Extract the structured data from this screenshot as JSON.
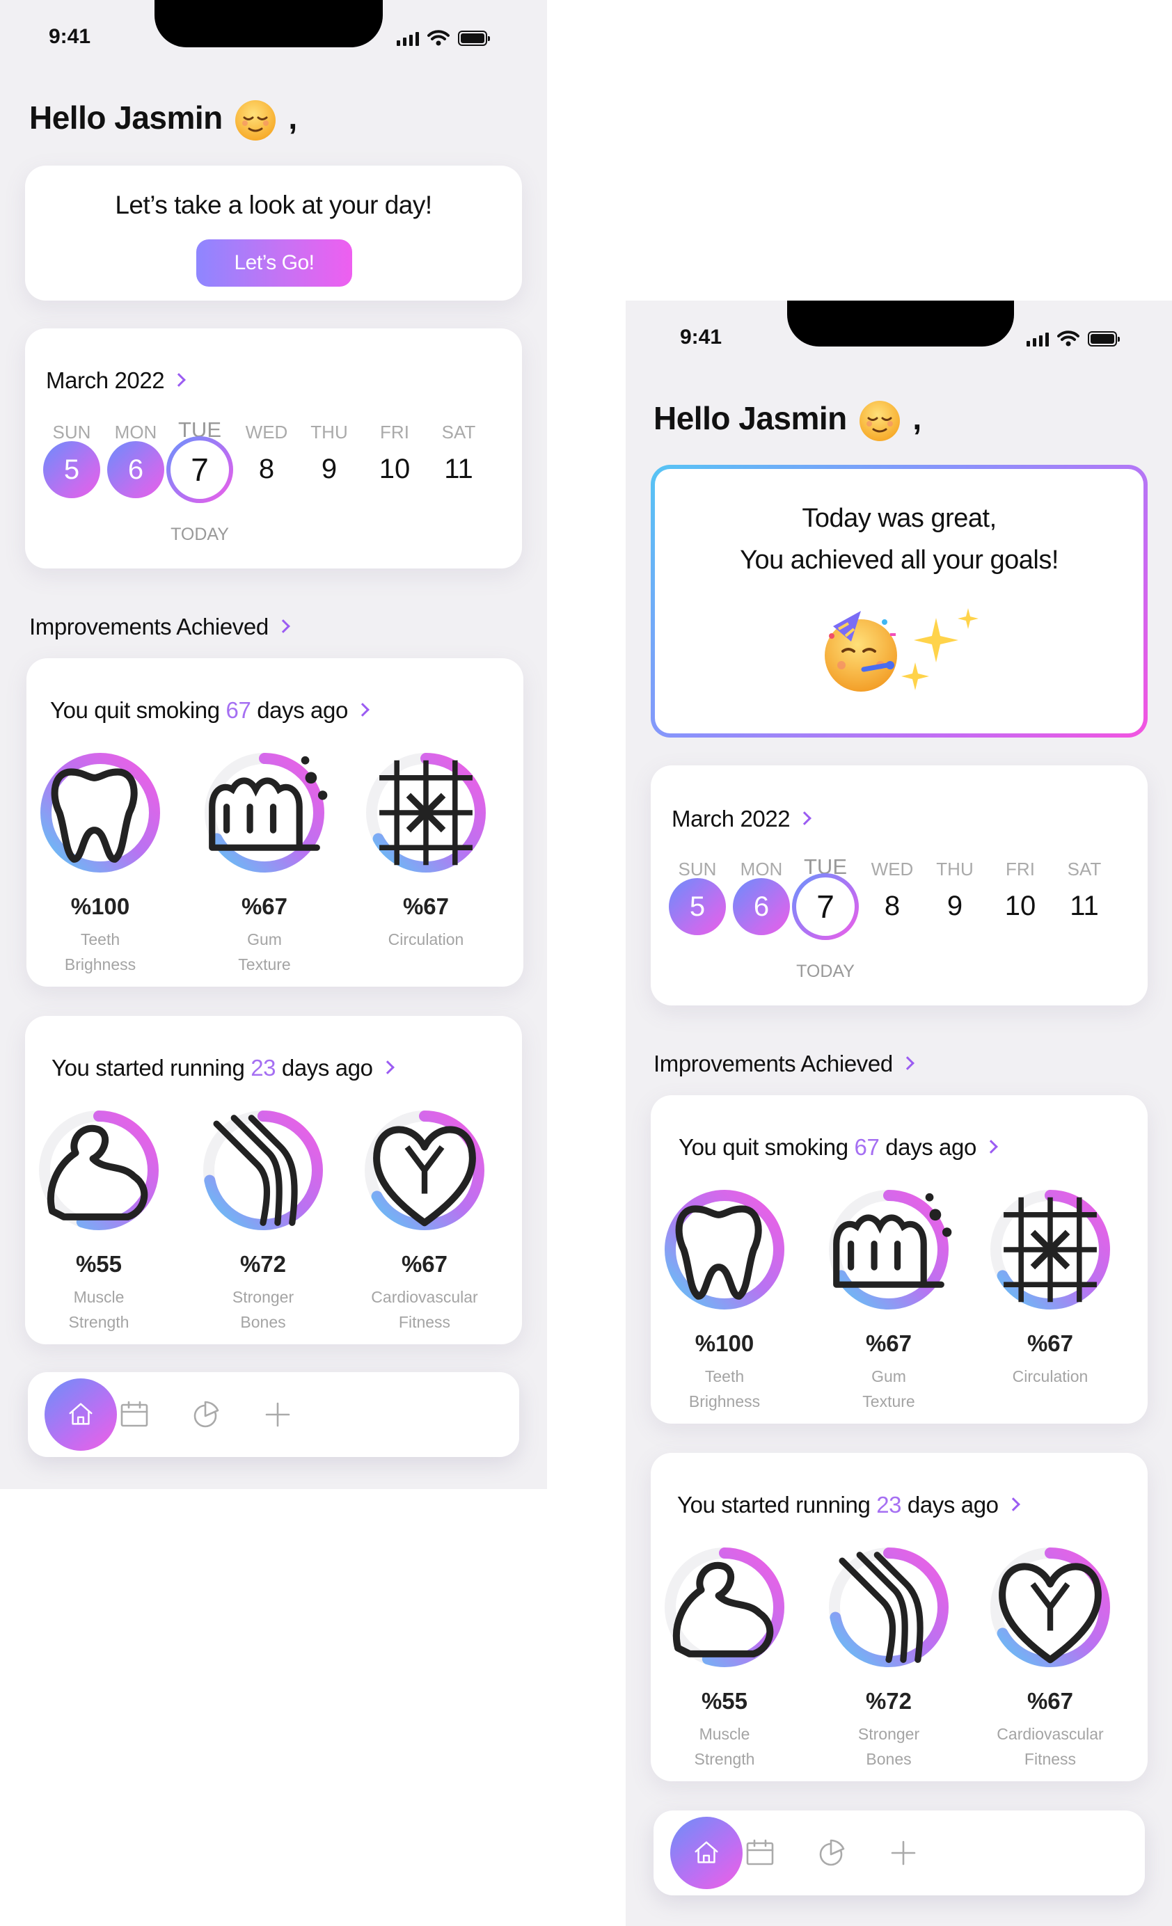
{
  "screen1": {
    "status": {
      "time": "9:41"
    },
    "greeting": {
      "text": "Hello Jasmin",
      "suffix": ","
    },
    "intro_card": {
      "title": "Let’s take a look at your day!",
      "button": "Let’s Go!"
    },
    "calendar": {
      "month": "March 2022",
      "days": [
        {
          "name": "SUN",
          "num": "5",
          "state": "done"
        },
        {
          "name": "MON",
          "num": "6",
          "state": "done"
        },
        {
          "name": "TUE",
          "num": "7",
          "state": "today"
        },
        {
          "name": "WED",
          "num": "8",
          "state": ""
        },
        {
          "name": "THU",
          "num": "9",
          "state": ""
        },
        {
          "name": "FRI",
          "num": "10",
          "state": ""
        },
        {
          "name": "SAT",
          "num": "11",
          "state": ""
        }
      ],
      "today_label": "TODAY"
    },
    "improvements_title": "Improvements Achieved",
    "smoking": {
      "pre": "You quit smoking",
      "num": "67",
      "post": "days ago",
      "metrics": [
        {
          "value": "%100",
          "fraction": 1.0,
          "line1": "Teeth",
          "line2": "Brighness",
          "icon": "tooth-icon"
        },
        {
          "value": "%67",
          "fraction": 0.67,
          "line1": "Gum",
          "line2": "Texture",
          "icon": "gum-icon"
        },
        {
          "value": "%67",
          "fraction": 0.67,
          "line1": "Circulation",
          "line2": "",
          "icon": "circulation-icon"
        }
      ]
    },
    "running": {
      "pre": "You started running",
      "num": "23",
      "post": "days ago",
      "metrics": [
        {
          "value": "%55",
          "fraction": 0.55,
          "line1": "Muscle",
          "line2": "Strength",
          "icon": "muscle-icon"
        },
        {
          "value": "%72",
          "fraction": 0.72,
          "line1": "Stronger",
          "line2": "Bones",
          "icon": "bone-icon"
        },
        {
          "value": "%67",
          "fraction": 0.67,
          "line1": "Cardiovascular",
          "line2": "Fitness",
          "icon": "heart-icon"
        }
      ]
    },
    "nav": {
      "items": [
        "home-icon",
        "calendar-icon",
        "chart-icon",
        "plus-icon"
      ],
      "active": "home-icon"
    }
  },
  "screen2": {
    "status": {
      "time": "9:41"
    },
    "greeting": {
      "text": "Hello Jasmin",
      "suffix": ","
    },
    "goal_card": {
      "line1": "Today was great,",
      "line2": "You achieved all your goals!"
    },
    "calendar": {
      "month": "March 2022",
      "days": [
        {
          "name": "SUN",
          "num": "5",
          "state": "done"
        },
        {
          "name": "MON",
          "num": "6",
          "state": "done"
        },
        {
          "name": "TUE",
          "num": "7",
          "state": "today"
        },
        {
          "name": "WED",
          "num": "8",
          "state": ""
        },
        {
          "name": "THU",
          "num": "9",
          "state": ""
        },
        {
          "name": "FRI",
          "num": "10",
          "state": ""
        },
        {
          "name": "SAT",
          "num": "11",
          "state": ""
        }
      ],
      "today_label": "TODAY"
    },
    "improvements_title": "Improvements Achieved",
    "smoking": {
      "pre": "You quit smoking",
      "num": "67",
      "post": "days ago",
      "metrics": [
        {
          "value": "%100",
          "fraction": 1.0,
          "line1": "Teeth",
          "line2": "Brighness",
          "icon": "tooth-icon"
        },
        {
          "value": "%67",
          "fraction": 0.67,
          "line1": "Gum",
          "line2": "Texture",
          "icon": "gum-icon"
        },
        {
          "value": "%67",
          "fraction": 0.67,
          "line1": "Circulation",
          "line2": "",
          "icon": "circulation-icon"
        }
      ]
    },
    "running": {
      "pre": "You started running",
      "num": "23",
      "post": "days ago",
      "metrics": [
        {
          "value": "%55",
          "fraction": 0.55,
          "line1": "Muscle",
          "line2": "Strength",
          "icon": "muscle-icon"
        },
        {
          "value": "%72",
          "fraction": 0.72,
          "line1": "Stronger",
          "line2": "Bones",
          "icon": "bone-icon"
        },
        {
          "value": "%67",
          "fraction": 0.67,
          "line1": "Cardiovascular",
          "line2": "Fitness",
          "icon": "heart-icon"
        }
      ]
    },
    "nav": {
      "items": [
        "home-icon",
        "calendar-icon",
        "chart-icon",
        "plus-icon"
      ],
      "active": "home-icon"
    }
  },
  "colors": {
    "accent": "#a56ff2",
    "gradient_start": "#5ec7f5",
    "gradient_mid": "#b873f2",
    "gradient_end": "#f15ee3",
    "track": "#f1f1f3",
    "background": "#f1f0f3"
  }
}
